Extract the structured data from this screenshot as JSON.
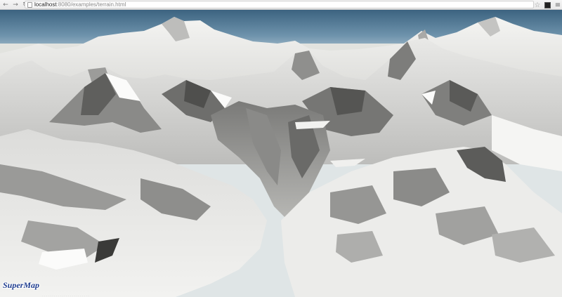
{
  "browser": {
    "url_host": "localhost",
    "url_rest": ":8080/examples/terrain.html"
  },
  "map": {
    "logo_text": "SuperMap"
  },
  "icons": {
    "back": "back-arrow-icon",
    "forward": "forward-arrow-icon",
    "reload": "reload-icon",
    "page": "page-icon",
    "bookmark": "star-icon",
    "extension": "extension-icon",
    "menu": "menu-icon"
  },
  "colors": {
    "sky_top": "#3c6380",
    "logo": "#1f3d8f"
  }
}
